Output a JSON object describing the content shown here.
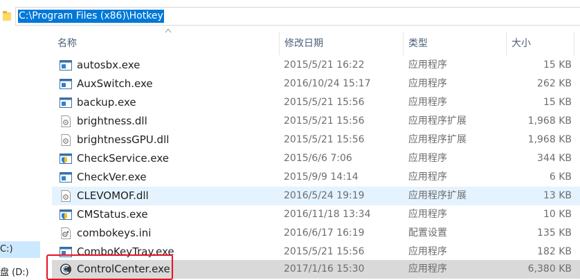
{
  "address_bar": {
    "path": "C:\\Program Files (x86)\\Hotkey"
  },
  "nav_pane": {
    "items": [
      {
        "label": "C:)"
      },
      {
        "label": "盘 (D:)"
      }
    ]
  },
  "columns": {
    "name": "名称",
    "date": "修改日期",
    "type": "类型",
    "size": "大小"
  },
  "files": [
    {
      "name": "autosbx.exe",
      "date": "2015/5/21 16:22",
      "type": "应用程序",
      "size": "15 KB",
      "icon": "app-window-icon"
    },
    {
      "name": "AuxSwitch.exe",
      "date": "2016/10/24 15:17",
      "type": "应用程序",
      "size": "262 KB",
      "icon": "app-window-icon"
    },
    {
      "name": "backup.exe",
      "date": "2015/5/21 15:56",
      "type": "应用程序",
      "size": "15 KB",
      "icon": "app-window-icon"
    },
    {
      "name": "brightness.dll",
      "date": "2015/5/21 15:56",
      "type": "应用程序扩展",
      "size": "1,968 KB",
      "icon": "dll-gear-icon"
    },
    {
      "name": "brightnessGPU.dll",
      "date": "2015/5/21 15:56",
      "type": "应用程序扩展",
      "size": "1,968 KB",
      "icon": "dll-gear-icon"
    },
    {
      "name": "CheckService.exe",
      "date": "2015/6/6 7:06",
      "type": "应用程序",
      "size": "344 KB",
      "icon": "app-shield-icon"
    },
    {
      "name": "CheckVer.exe",
      "date": "2015/9/9 14:14",
      "type": "应用程序",
      "size": "6 KB",
      "icon": "app-window-icon"
    },
    {
      "name": "CLEVOMOF.dll",
      "date": "2016/5/24 19:19",
      "type": "应用程序扩展",
      "size": "13 KB",
      "icon": "dll-gear-icon"
    },
    {
      "name": "CMStatus.exe",
      "date": "2016/11/18 13:34",
      "type": "应用程序",
      "size": "10 KB",
      "icon": "app-shield-icon"
    },
    {
      "name": "combokeys.ini",
      "date": "2016/6/17 16:19",
      "type": "配置设置",
      "size": "135 KB",
      "icon": "ini-settings-icon"
    },
    {
      "name": "ComboKeyTray.exe",
      "date": "2015/5/21 15:56",
      "type": "应用程序",
      "size": "182 KB",
      "icon": "app-window-icon"
    },
    {
      "name": "ControlCenter.exe",
      "date": "2017/1/16 15:30",
      "type": "应用程序",
      "size": "6,380 KB",
      "icon": "control-center-icon"
    }
  ],
  "colors": {
    "selection_blue": "#0078d7",
    "hover_row": "#e5f3ff",
    "selected_row": "#d9d9d9",
    "highlight_frame": "#e81123"
  }
}
